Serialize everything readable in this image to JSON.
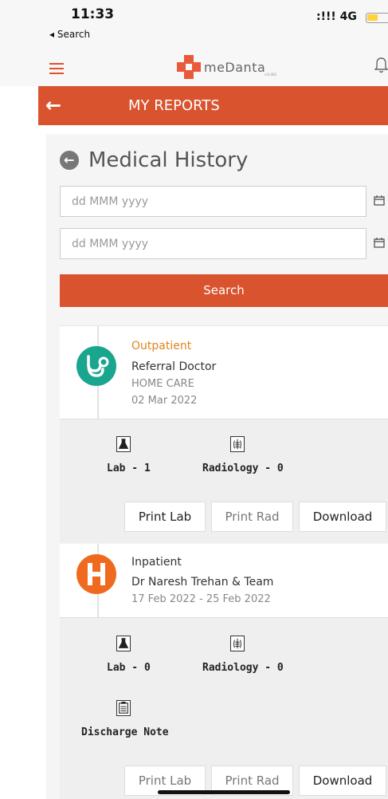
{
  "status_bar": {
    "time": "11:33",
    "back_label": "◂ Search",
    "signal": ":!!! 4G"
  },
  "app_bar": {
    "logo_text": "meDanta",
    "logo_sub": "eCLINIC"
  },
  "title_bar": {
    "title": "MY REPORTS"
  },
  "medical_history": {
    "title": "Medical History",
    "from_date_placeholder": "dd MMM yyyy",
    "to_date_placeholder": "dd MMM yyyy",
    "search_label": "Search"
  },
  "records": [
    {
      "type": "Outpatient",
      "type_color": "#e0861d",
      "doctor": "Referral Doctor",
      "department": "HOME CARE",
      "date": "02 Mar 2022",
      "lab_label": "Lab - 1",
      "radiology_label": "Radiology - 0",
      "print_lab_label": "Print Lab",
      "print_rad_label": "Print Rad",
      "download_label": "Download"
    },
    {
      "type": "Inpatient",
      "type_color": "#333333",
      "doctor": "Dr Naresh Trehan & Team",
      "date": "17 Feb 2022 - 25 Feb 2022",
      "lab_label": "Lab - 0",
      "radiology_label": "Radiology - 0",
      "discharge_label": "Discharge Note",
      "print_lab_label": "Print Lab",
      "print_rad_label": "Print Rad",
      "download_label": "Download"
    }
  ],
  "colors": {
    "accent": "#d9532e",
    "outpatient_icon": "#1aa58e",
    "inpatient_icon": "#ef6a1f"
  }
}
